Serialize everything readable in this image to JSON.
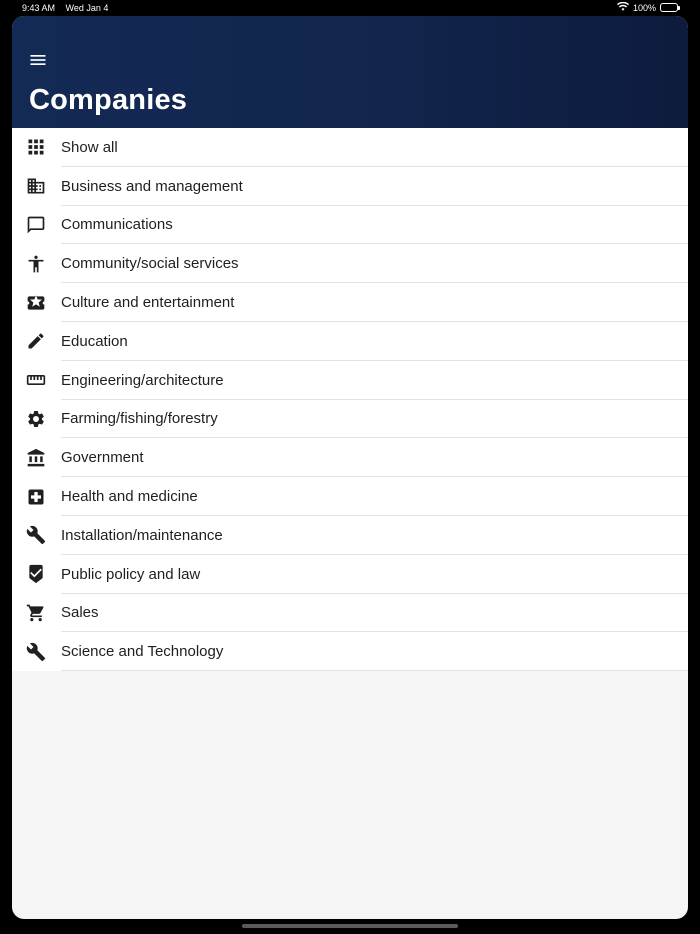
{
  "status_bar": {
    "time": "9:43 AM",
    "date": "Wed Jan 4",
    "battery": "100%",
    "wifi_icon": "wifi-icon",
    "battery_icon": "battery-icon"
  },
  "header": {
    "menu_icon": "hamburger-menu-icon",
    "title": "Companies"
  },
  "categories": [
    {
      "label": "Show all",
      "icon": "grid-icon"
    },
    {
      "label": "Business and management",
      "icon": "building-icon"
    },
    {
      "label": "Communications",
      "icon": "chat-bubble-icon"
    },
    {
      "label": "Community/social services",
      "icon": "accessibility-person-icon"
    },
    {
      "label": "Culture and entertainment",
      "icon": "ticket-star-icon"
    },
    {
      "label": "Education",
      "icon": "pencil-icon"
    },
    {
      "label": "Engineering/architecture",
      "icon": "ruler-icon"
    },
    {
      "label": "Farming/fishing/forestry",
      "icon": "gear-icon"
    },
    {
      "label": "Government",
      "icon": "bank-icon"
    },
    {
      "label": "Health and medicine",
      "icon": "medical-cross-icon"
    },
    {
      "label": "Installation/maintenance",
      "icon": "wrench-icon"
    },
    {
      "label": "Public policy and law",
      "icon": "shield-check-icon"
    },
    {
      "label": "Sales",
      "icon": "shopping-cart-icon"
    },
    {
      "label": "Science and Technology",
      "icon": "wrench-icon"
    }
  ],
  "colors": {
    "header_bg": "#132a55",
    "list_bg": "#ffffff",
    "page_bg": "#f5f5f5",
    "text": "#1f1f1f",
    "icon": "#202020"
  }
}
